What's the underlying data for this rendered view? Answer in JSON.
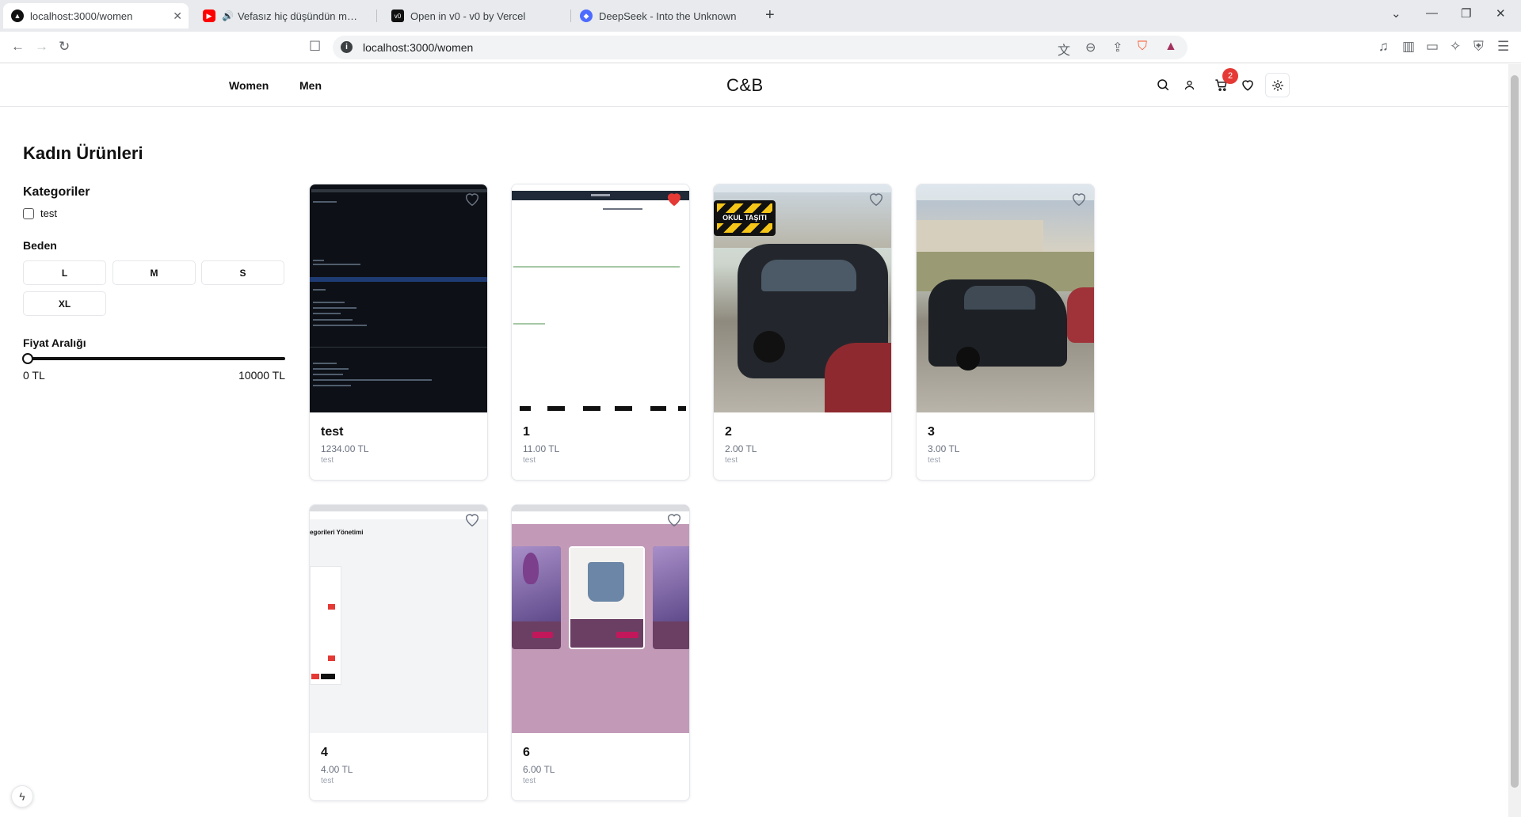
{
  "browser": {
    "tabs": [
      {
        "title": "localhost:3000/women",
        "active": true
      },
      {
        "title": "Vefasız hiç düşündün mü?-spee",
        "active": false
      },
      {
        "title": "Open in v0 - v0 by Vercel",
        "active": false
      },
      {
        "title": "DeepSeek - Into the Unknown",
        "active": false
      }
    ],
    "url": "localhost:3000/women"
  },
  "site": {
    "logo": "C&B",
    "nav": [
      {
        "label": "Women"
      },
      {
        "label": "Men"
      }
    ],
    "cart_count": "2"
  },
  "page": {
    "title": "Kadın Ürünleri",
    "filters": {
      "categories_title": "Kategoriler",
      "categories": [
        {
          "label": "test"
        }
      ],
      "size_title": "Beden",
      "sizes": [
        "L",
        "M",
        "S",
        "XL"
      ],
      "price_title": "Fiyat Aralığı",
      "price_min": "0 TL",
      "price_max": "10000 TL",
      "price_value_fraction": 0
    }
  },
  "products": [
    {
      "name": "test",
      "price": "1234.00 TL",
      "category": "test",
      "favorite": false,
      "image": "code-screenshot"
    },
    {
      "name": "1",
      "price": "11.00 TL",
      "category": "test",
      "favorite": true,
      "image": "web-screenshot"
    },
    {
      "name": "2",
      "price": "2.00 TL",
      "category": "test",
      "favorite": false,
      "image": "car-photo",
      "image_text": "OKUL TAŞITI"
    },
    {
      "name": "3",
      "price": "3.00 TL",
      "category": "test",
      "favorite": false,
      "image": "car-photo"
    },
    {
      "name": "4",
      "price": "4.00 TL",
      "category": "test",
      "favorite": false,
      "image": "admin-screenshot",
      "image_text": "egorileri Yönetimi"
    },
    {
      "name": "6",
      "price": "6.00 TL",
      "category": "test",
      "favorite": false,
      "image": "shop-screenshot"
    }
  ],
  "colors": {
    "badge": "#e53935",
    "heart_active": "#e53935",
    "purple": "#c29ab8"
  }
}
